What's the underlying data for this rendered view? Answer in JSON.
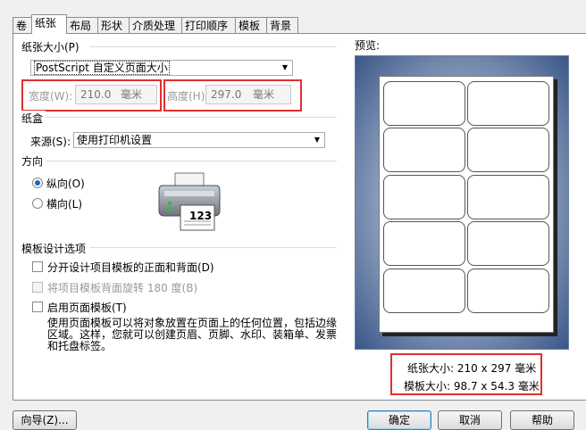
{
  "tabs": [
    "卷",
    "纸张",
    "布局",
    "形状",
    "介质处理",
    "打印顺序",
    "模板",
    "背景"
  ],
  "paper_size": {
    "section_title": "纸张大小(P)",
    "select_value": "PostScript 自定义页面大小",
    "width_label": "宽度(W):",
    "width_value": "210.0",
    "width_unit": "毫米",
    "height_label": "高度(H):",
    "height_value": "297.0",
    "height_unit": "毫米"
  },
  "paper_tray": {
    "section_title": "纸盒",
    "source_label": "来源(S):",
    "source_value": "使用打印机设置"
  },
  "orientation": {
    "section_title": "方向",
    "portrait_label": "纵向(O)",
    "landscape_label": "横向(L)",
    "selected": "portrait",
    "printer_sheet_text": "123"
  },
  "template_options": {
    "section_title": "模板设计选项",
    "option1_label": "分开设计项目模板的正面和背面(D)",
    "option2_label": "将项目模板背面旋转 180 度(B)",
    "option3_label": "启用页面模板(T)",
    "description_line1": "使用页面模板可以将对象放置在页面上的任何位置，包括边缘",
    "description_line2": "区域。这样，您就可以创建页眉、页脚、水印、装箱单、发票",
    "description_line3": "和托盘标签。"
  },
  "preview": {
    "label": "预览:",
    "label_grid": {
      "rows": 5,
      "cols": 2
    },
    "paper_size_text": "纸张大小: 210 x 297 毫米",
    "template_size_text": "模板大小: 98.7 x 54.3 毫米"
  },
  "buttons": {
    "wizard": "向导(Z)...",
    "ok": "确定",
    "cancel": "取消",
    "help": "帮助"
  },
  "colors": {
    "highlight_box": "#e03030",
    "radio_selected": "#1e62c9"
  }
}
